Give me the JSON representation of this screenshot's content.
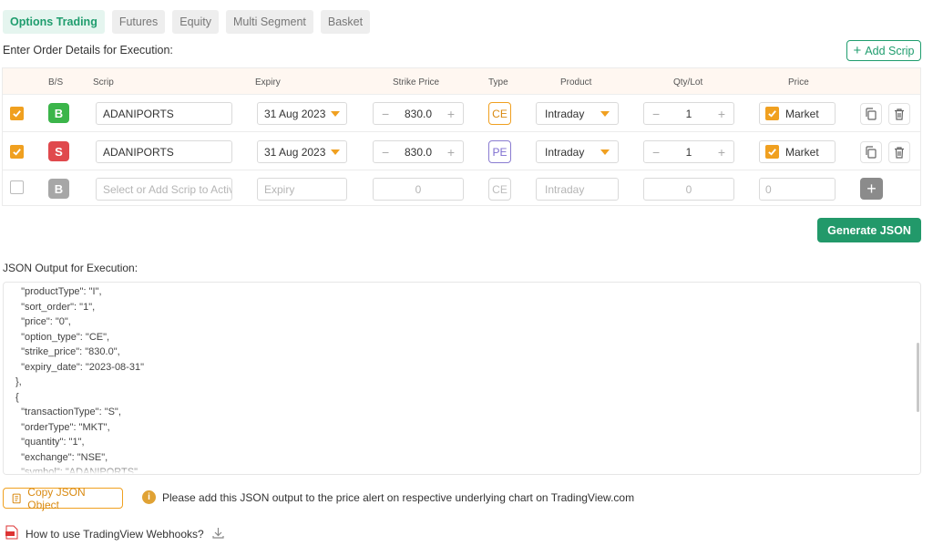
{
  "tabs": [
    {
      "label": "Options Trading"
    },
    {
      "label": "Futures"
    },
    {
      "label": "Equity"
    },
    {
      "label": "Multi Segment"
    },
    {
      "label": "Basket"
    }
  ],
  "order_heading": "Enter Order Details for Execution:",
  "add_scrip_label": "Add Scrip",
  "columns": {
    "bs": "B/S",
    "scrip": "Scrip",
    "expiry": "Expiry",
    "strike": "Strike Price",
    "type": "Type",
    "product": "Product",
    "qty": "Qty/Lot",
    "price": "Price"
  },
  "rows": [
    {
      "checked": true,
      "side": "B",
      "scrip": "ADANIPORTS",
      "expiry": "31 Aug 2023",
      "strike": "830.0",
      "type": "CE",
      "product": "Intraday",
      "qty": "1",
      "price_market": true,
      "price_label": "Market"
    },
    {
      "checked": true,
      "side": "S",
      "scrip": "ADANIPORTS",
      "expiry": "31 Aug 2023",
      "strike": "830.0",
      "type": "PE",
      "product": "Intraday",
      "qty": "1",
      "price_market": true,
      "price_label": "Market"
    }
  ],
  "new_row": {
    "side": "B",
    "scrip_placeholder": "Select or Add Scrip to Activate",
    "expiry_placeholder": "Expiry",
    "strike": "0",
    "type": "CE",
    "product_placeholder": "Intraday",
    "qty": "0",
    "price": "0"
  },
  "generate_label": "Generate JSON",
  "json_label": "JSON Output for Execution:",
  "json_text": "  \"productType\": \"I\",\n  \"sort_order\": \"1\",\n  \"price\": \"0\",\n  \"option_type\": \"CE\",\n  \"strike_price\": \"830.0\",\n  \"expiry_date\": \"2023-08-31\"\n},\n{\n  \"transactionType\": \"S\",\n  \"orderType\": \"MKT\",\n  \"quantity\": \"1\",\n  \"exchange\": \"NSE\",\n  \"symbol\": \"ADANIPORTS\"",
  "copy_json_label": "Copy JSON Object",
  "notice_text": "Please add this JSON output to the price alert on respective underlying chart on TradingView.com",
  "howto_label": "How to use TradingView Webhooks?",
  "colors": {
    "accent": "#1f9d6e",
    "orange": "#f0a020",
    "buy": "#3bb54a",
    "sell": "#e0494d"
  }
}
